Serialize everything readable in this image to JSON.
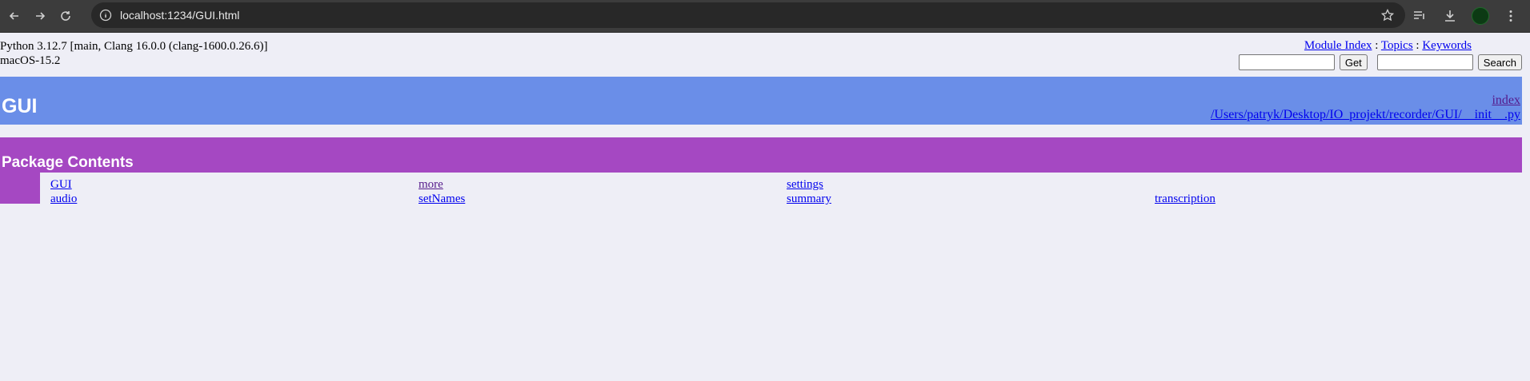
{
  "browser": {
    "url": "localhost:1234/GUI.html"
  },
  "header": {
    "python_version": "Python 3.12.7 [main, Clang 16.0.0 (clang-1600.0.26.6)]",
    "os": "macOS-15.2",
    "nav": {
      "module_index": "Module Index",
      "sep1": " : ",
      "topics": "Topics",
      "sep2": " : ",
      "keywords": "Keywords"
    },
    "get_button": "Get",
    "search_button": "Search",
    "get_input_value": "",
    "search_input_value": ""
  },
  "title_bar": {
    "title": "GUI",
    "index_link": "index",
    "file_path": "/Users/patryk/Desktop/IO_projekt/recorder/GUI/__init__.py"
  },
  "package_contents": {
    "heading": "Package Contents",
    "columns": [
      [
        "GUI",
        "audio"
      ],
      [
        "more",
        "setNames"
      ],
      [
        "settings",
        "summary"
      ],
      [
        "transcription"
      ]
    ]
  }
}
